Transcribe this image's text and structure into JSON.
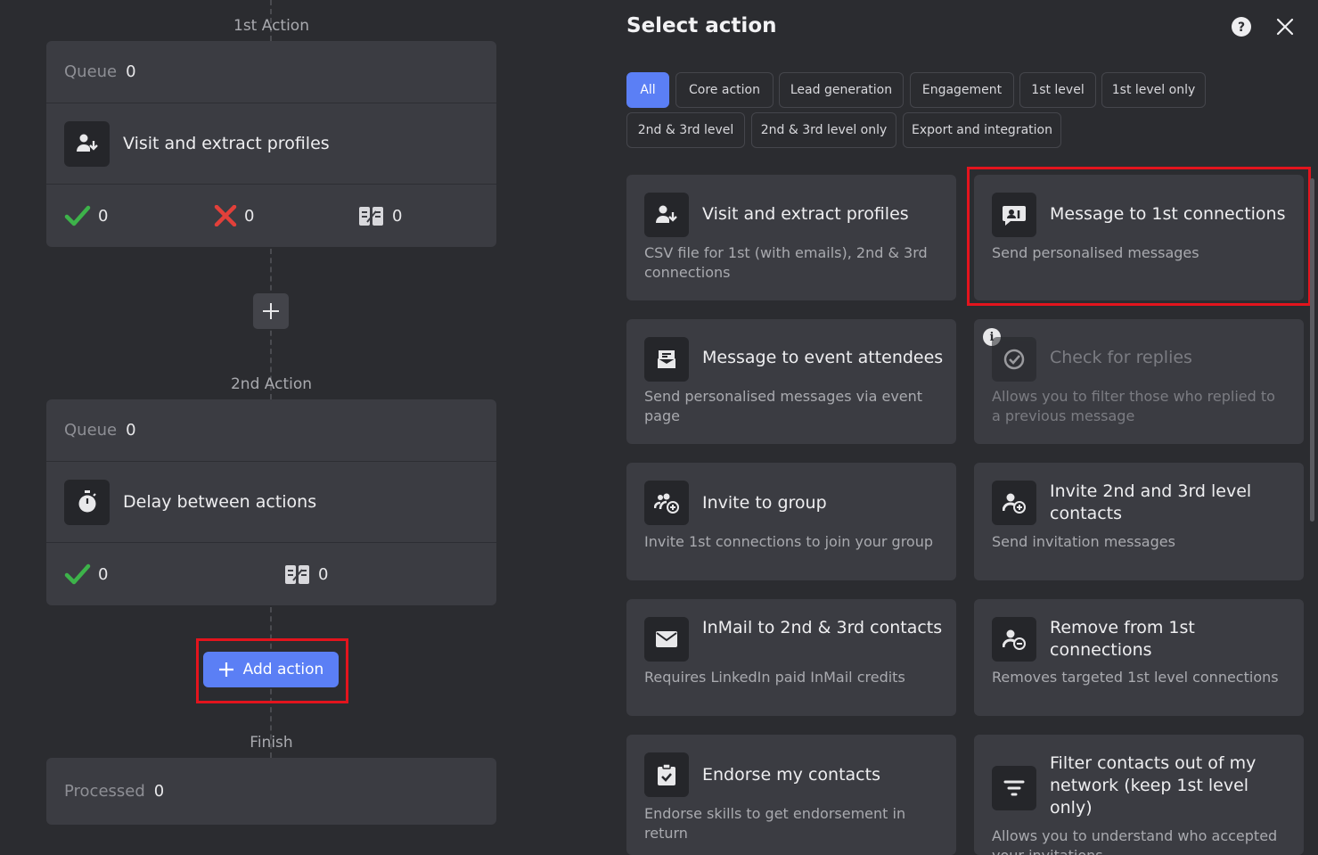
{
  "flow": {
    "step1_label": "1st Action",
    "step2_label": "2nd Action",
    "finish_label": "Finish",
    "queue_label": "Queue",
    "step1": {
      "queue": "0",
      "action": "Visit and extract profiles",
      "success": "0",
      "failed": "0",
      "skipped": "0"
    },
    "step2": {
      "queue": "0",
      "action": "Delay between actions",
      "success": "0",
      "skipped": "0"
    },
    "processed_label": "Processed",
    "processed": "0",
    "add_action_label": "Add action"
  },
  "panel": {
    "title": "Select action",
    "filters": [
      "All",
      "Core action",
      "Lead generation",
      "Engagement",
      "1st level",
      "1st level only",
      "2nd & 3rd level",
      "2nd & 3rd level only",
      "Export and integration"
    ],
    "actions": [
      {
        "title": "Visit and extract profiles",
        "desc": "CSV file for 1st (with emails), 2nd & 3rd connections",
        "icon": "user-download-icon"
      },
      {
        "title": "Message to 1st connections",
        "desc": "Send personalised messages",
        "icon": "message-user-icon"
      },
      {
        "title": "Message to event attendees",
        "desc": "Send personalised messages via event page",
        "icon": "event-message-icon"
      },
      {
        "title": "Check for replies",
        "desc": "Allows you to filter those who replied to a previous message",
        "icon": "reply-check-icon",
        "disabled": true
      },
      {
        "title": "Invite to group",
        "desc": "Invite 1st connections to join your group",
        "icon": "group-invite-icon"
      },
      {
        "title": "Invite 2nd and 3rd level contacts",
        "desc": "Send invitation messages",
        "icon": "user-add-icon"
      },
      {
        "title": "InMail to 2nd & 3rd contacts",
        "desc": "Requires LinkedIn paid InMail credits",
        "icon": "mail-icon"
      },
      {
        "title": "Remove from 1st connections",
        "desc": "Removes targeted 1st level connections",
        "icon": "user-remove-icon"
      },
      {
        "title": "Endorse my contacts",
        "desc": "Endorse skills to get endorsement in return",
        "icon": "clipboard-check-icon"
      },
      {
        "title": "Filter contacts out of my network (keep 1st level only)",
        "desc": "Allows you to understand who accepted your invitations",
        "icon": "filter-icon"
      }
    ]
  },
  "colors": {
    "accent": "#5b7ff5",
    "highlight": "#e3141d",
    "success": "#3db34a",
    "error": "#e2403a"
  }
}
